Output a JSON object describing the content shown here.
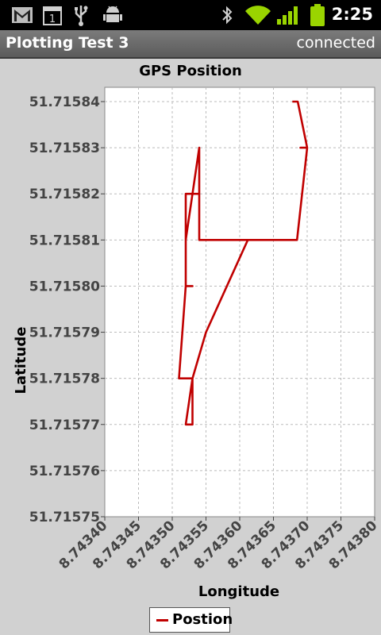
{
  "status_bar": {
    "time": "2:25",
    "icons": [
      "gmail-icon",
      "calendar-icon",
      "usb-icon",
      "android-debug-icon",
      "bluetooth-icon",
      "wifi-icon",
      "signal-icon",
      "battery-icon"
    ],
    "calendar_day": "1"
  },
  "app": {
    "title": "Plotting Test 3",
    "connection_status": "connected"
  },
  "colors": {
    "series": "#c00000",
    "plot_bg": "#ffffff",
    "outer_bg": "#d1d1d1"
  },
  "chart_data": {
    "type": "line",
    "title": "GPS Position",
    "xlabel": "Longitude",
    "ylabel": "Latitude",
    "xlim": [
      8.7434,
      8.7438
    ],
    "ylim": [
      51.71575,
      51.71584
    ],
    "x_ticks": [
      "8.74340",
      "8.74345",
      "8.74350",
      "8.74355",
      "8.74360",
      "8.74365",
      "8.74370",
      "8.74375",
      "8.74380"
    ],
    "y_ticks": [
      "51.71584",
      "51.71583",
      "51.71582",
      "51.71581",
      "51.71580",
      "51.71579",
      "51.71578",
      "51.71577",
      "51.71576",
      "51.71575"
    ],
    "grid": true,
    "legend_position": "bottom-center",
    "series": [
      {
        "name": "Postion",
        "x": [
          8.743678,
          8.743686,
          8.7437,
          8.74369,
          8.7437,
          8.743685,
          8.743612,
          8.74354,
          8.74354,
          8.74352,
          8.74352,
          8.74354,
          8.74354,
          8.74352,
          8.74352,
          8.74353,
          8.74352,
          8.74351,
          8.74353,
          8.74352,
          8.74353,
          8.74353,
          8.74355,
          8.743612,
          8.743685
        ],
        "y": [
          51.71584,
          51.71584,
          51.71583,
          51.71583,
          51.71583,
          51.71581,
          51.71581,
          51.71581,
          51.71583,
          51.71581,
          51.71582,
          51.71582,
          51.71582,
          51.71582,
          51.7158,
          51.7158,
          51.7158,
          51.71578,
          51.71578,
          51.71577,
          51.71577,
          51.71578,
          51.71579,
          51.71581,
          51.71581
        ]
      }
    ]
  }
}
